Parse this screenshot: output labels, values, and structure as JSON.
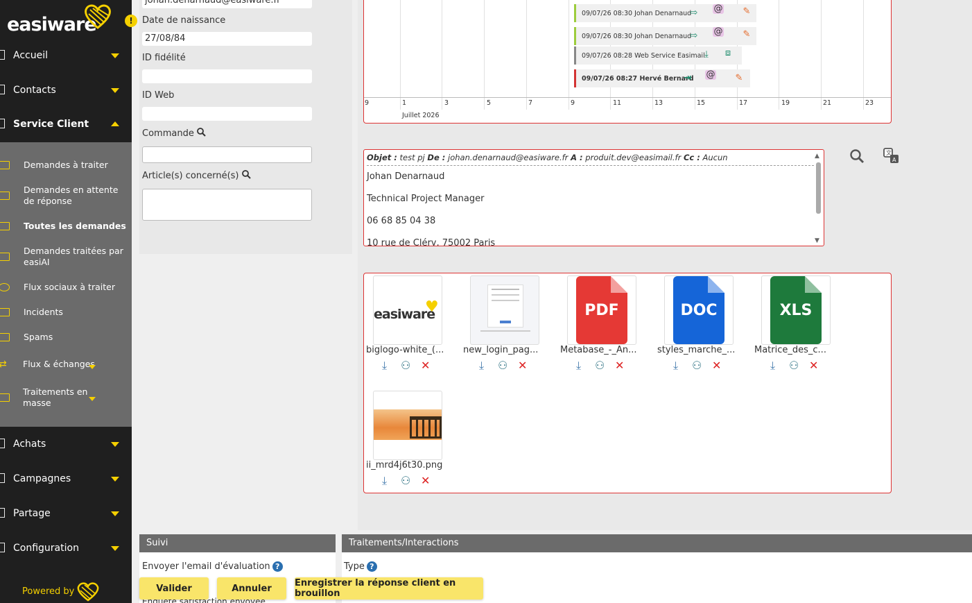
{
  "brand": {
    "logo": "easiware",
    "powered_by": "Powered by"
  },
  "sidebar": {
    "items": [
      {
        "label": "Accueil"
      },
      {
        "label": "Contacts"
      },
      {
        "label": "Service Client"
      },
      {
        "label": "Achats"
      },
      {
        "label": "Campagnes"
      },
      {
        "label": "Partage"
      },
      {
        "label": "Configuration"
      }
    ],
    "service_client_sub": [
      {
        "label": "Demandes à traiter"
      },
      {
        "label": "Demandes en attente de réponse"
      },
      {
        "label": "Toutes les demandes"
      },
      {
        "label": "Demandes traitées par easiAI"
      },
      {
        "label": "Flux sociaux à traiter"
      },
      {
        "label": "Incidents"
      },
      {
        "label": "Spams"
      },
      {
        "label": "Flux & échanges"
      },
      {
        "label": "Traitements en masse"
      }
    ]
  },
  "contact_form": {
    "email_value": "johan.denarnaud@easiware.fr",
    "dob_label": "Date de naissance",
    "dob_value": "27/08/84",
    "fidelite_label": "ID fidélité",
    "fidelite_value": "",
    "web_label": "ID Web",
    "web_value": "",
    "commande_label": "Commande",
    "commande_value": "",
    "articles_label": "Article(s) concerné(s)",
    "articles_value": "",
    "warning_icon": "!"
  },
  "timeline": {
    "events": [
      {
        "text": "09/07/26 08:30 Johan Denarnaud",
        "color": "#9ccc3c"
      },
      {
        "text": "09/07/26 08:30 Johan Denarnaud",
        "color": "#9ccc3c"
      },
      {
        "text": "09/07/26 08:28 Web Service Easimail",
        "color": "#888888"
      },
      {
        "text": "09/07/26 08:27 Hervé Bernard",
        "color": "#d33333"
      }
    ],
    "ticks": [
      "9",
      "1",
      "3",
      "5",
      "7",
      "9",
      "11",
      "13",
      "15",
      "17",
      "19",
      "21",
      "23"
    ],
    "month": "Juillet 2026"
  },
  "email": {
    "objet_label": "Objet :",
    "objet_value": "test pj",
    "de_label": "De :",
    "de_value": "johan.denarnaud@easiware.fr",
    "a_label": "A :",
    "a_value": "produit.dev@easimail.fr",
    "cc_label": "Cc :",
    "cc_value": "Aucun",
    "body": [
      "Johan Denarnaud",
      "Technical Project Manager",
      "06 68 85 04 38",
      "10 rue de Cléry, 75002 Paris"
    ]
  },
  "attachments": [
    {
      "name": "biglogo-white_(...",
      "kind": "logo"
    },
    {
      "name": "new_login_pag...",
      "kind": "screenshot"
    },
    {
      "name": "Metabase_-_An...",
      "kind": "PDF",
      "color": "#e53935"
    },
    {
      "name": "styles_marche_...",
      "kind": "DOC",
      "color": "#1565d8"
    },
    {
      "name": "Matrice_des_c...",
      "kind": "XLS",
      "color": "#1e7a3c"
    },
    {
      "name": "ii_mrd4j6t30.png",
      "kind": "photo"
    }
  ],
  "suivi": {
    "title": "Suivi",
    "eval_label": "Envoyer l'email d'évaluation",
    "enquete_label": "Enquête satisfaction envoyée"
  },
  "traitements": {
    "title": "Traitements/Interactions",
    "type_label": "Type"
  },
  "actions": {
    "valider": "Valider",
    "annuler": "Annuler",
    "brouillon": "Enregistrer la réponse client en brouillon"
  },
  "colors": {
    "accent": "#f5d000",
    "sidebar": "#1f1f1f",
    "sub": "#6b6b6b",
    "border_red": "#d33333"
  }
}
